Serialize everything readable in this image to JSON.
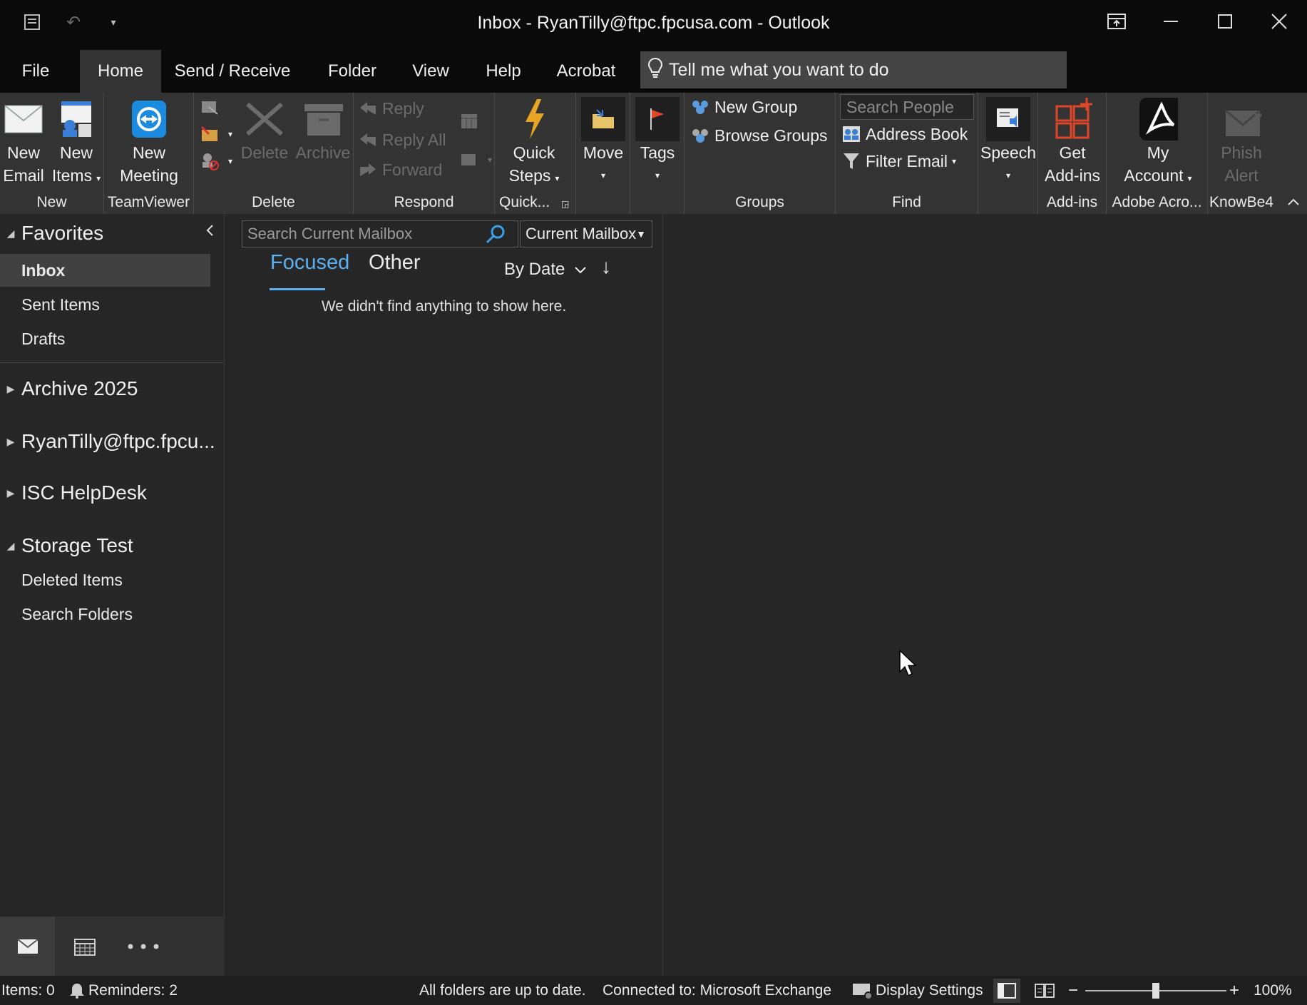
{
  "window": {
    "title": "Inbox - RyanTilly@ftpc.fpcusa.com  -  Outlook",
    "quick_access_more": "▾"
  },
  "menu": {
    "tabs": [
      "File",
      "Home",
      "Send / Receive",
      "Folder",
      "View",
      "Help",
      "Acrobat"
    ],
    "active": "Home",
    "tell_me": "Tell me what you want to do"
  },
  "ribbon": {
    "new": {
      "label": "New",
      "new_email": [
        "New",
        "Email"
      ],
      "new_items": [
        "New",
        "Items"
      ]
    },
    "teamviewer": {
      "label": "TeamViewer",
      "new_meeting": [
        "New",
        "Meeting"
      ]
    },
    "delete": {
      "label": "Delete",
      "delete": "Delete",
      "archive": "Archive"
    },
    "respond": {
      "label": "Respond",
      "reply": "Reply",
      "reply_all": "Reply All",
      "forward": "Forward"
    },
    "quick_steps": {
      "label": "Quick...",
      "button": [
        "Quick",
        "Steps"
      ]
    },
    "move": {
      "button": "Move"
    },
    "tags": {
      "button": "Tags"
    },
    "groups": {
      "label": "Groups",
      "new_group": "New Group",
      "browse_groups": "Browse Groups"
    },
    "find": {
      "label": "Find",
      "search_people": "Search People",
      "address_book": "Address Book",
      "filter_email": "Filter Email"
    },
    "speech": {
      "button": "Speech"
    },
    "addins": {
      "label": "Add-ins",
      "button": [
        "Get",
        "Add-ins"
      ]
    },
    "adobe": {
      "label": "Adobe Acro...",
      "button": [
        "My",
        "Account"
      ]
    },
    "knowbe4": {
      "label": "KnowBe4",
      "button": [
        "Phish",
        "Alert"
      ]
    }
  },
  "nav": {
    "favorites": "Favorites",
    "favorites_items": [
      "Inbox",
      "Sent Items",
      "Drafts"
    ],
    "selected": "Inbox",
    "accounts": [
      "Archive 2025",
      "RyanTilly@ftpc.fpcu...",
      "ISC HelpDesk",
      "Storage Test"
    ],
    "storage_test_items": [
      "Deleted Items",
      "Search Folders"
    ]
  },
  "message_list": {
    "search_placeholder": "Search Current Mailbox",
    "scope": "Current Mailbox",
    "tab_focused": "Focused",
    "tab_other": "Other",
    "sort": "By Date",
    "sort_direction": "↓",
    "empty_text": "We didn't find anything to show here."
  },
  "status": {
    "items": "Items: 0",
    "reminders": "Reminders: 2",
    "sync": "All folders are up to date.",
    "connection": "Connected to: Microsoft Exchange",
    "display_settings": "Display Settings",
    "zoom": "100%",
    "zoom_level": 0.5
  },
  "colors": {
    "accent": "#5ab0f0",
    "background": "#262626",
    "ribbon": "#333333",
    "titlebar": "#0a0a0a"
  }
}
